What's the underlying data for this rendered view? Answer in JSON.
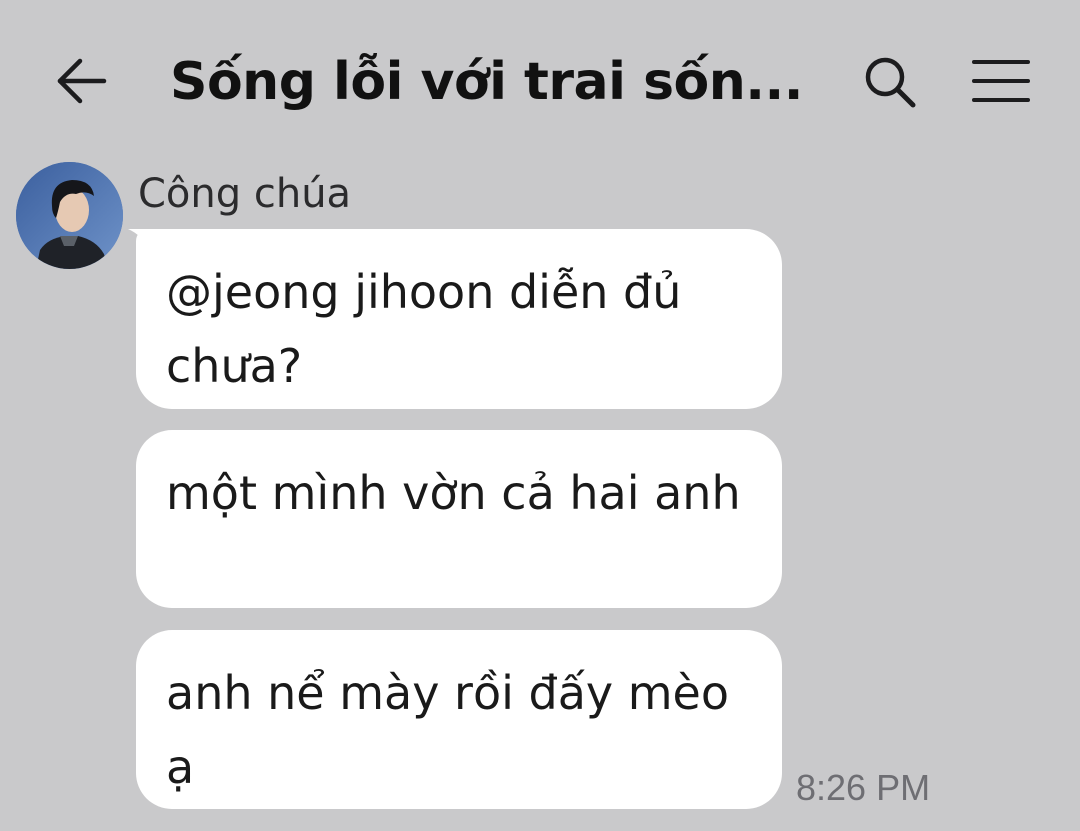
{
  "header": {
    "title": "Sống lỗi với trai sốn...",
    "back_icon": "arrow-left-icon",
    "search_icon": "search-icon",
    "menu_icon": "hamburger-menu-icon"
  },
  "message_group": {
    "sender_name": "Công chúa",
    "avatar_icon": "avatar",
    "messages": [
      {
        "text": "@jeong jihoon diễn đủ chưa?"
      },
      {
        "text": "một mình vờn cả hai anh"
      },
      {
        "text": "anh nể mày rồi đấy mèo ạ"
      }
    ],
    "time": "8:26 PM"
  },
  "colors": {
    "background": "#c9c9cb",
    "bubble": "#ffffff",
    "text": "#1a1a1a",
    "timestamp": "#6e6e73"
  }
}
